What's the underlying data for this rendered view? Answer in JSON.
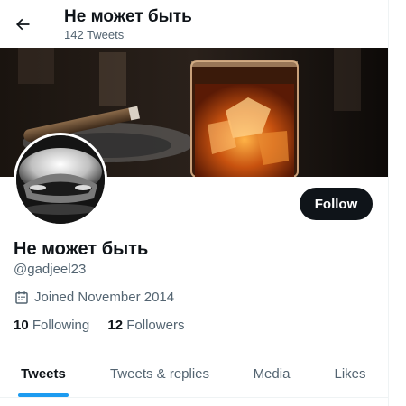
{
  "header": {
    "title": "Не может быть",
    "tweet_count": "142 Tweets",
    "back_icon": "arrow-left-icon"
  },
  "profile": {
    "display_name": "Не может быть",
    "handle": "@gadjeel23",
    "joined": "Joined November 2014",
    "joined_icon": "calendar-icon",
    "follow_label": "Follow",
    "following_count": "10",
    "following_label": "Following",
    "followers_count": "12",
    "followers_label": "Followers"
  },
  "tabs": [
    {
      "label": "Tweets",
      "active": true
    },
    {
      "label": "Tweets & replies",
      "active": false
    },
    {
      "label": "Media",
      "active": false
    },
    {
      "label": "Likes",
      "active": false
    }
  ],
  "colors": {
    "accent": "#1d9bf0",
    "text_primary": "#0f1419",
    "text_secondary": "#536471",
    "button_bg": "#0f1419"
  }
}
